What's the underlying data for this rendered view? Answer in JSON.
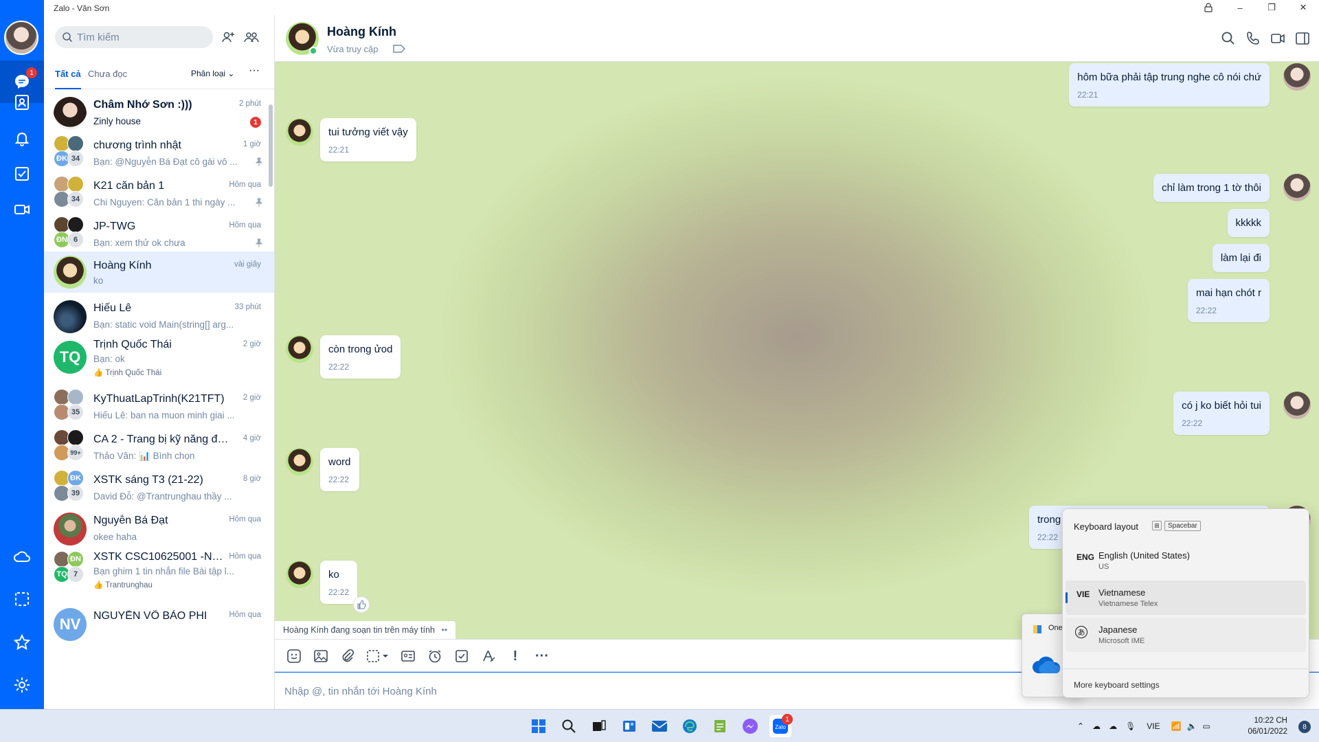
{
  "window": {
    "title": "Zalo - Văn Sơn"
  },
  "nav": {
    "chat_badge": "1"
  },
  "search": {
    "placeholder": "Tìm kiếm"
  },
  "tabs": {
    "all": "Tất cả",
    "unread": "Chưa đọc",
    "filter": "Phân loại"
  },
  "conversations": [
    {
      "name": "Châm Nhớ Sơn :)))",
      "preview": "Zinly house",
      "time": "2 phút",
      "unread": "1"
    },
    {
      "name": "chương trình nhật",
      "preview": "Bạn: @Nguyễn Bá Đạt cô gài vô ...",
      "time": "1 giờ",
      "members": "34",
      "initials": "ĐK"
    },
    {
      "name": "K21 căn bản 1",
      "preview": "Chi Nguyen: Căn bản 1 thi ngày ...",
      "time": "Hôm qua",
      "members": "34"
    },
    {
      "name": "JP-TWG",
      "preview": "Bạn: xem thử ok chưa",
      "time": "Hôm qua",
      "members": "6",
      "initials": "ĐN"
    },
    {
      "name": "Hoàng Kính",
      "preview": "ko",
      "time": "vài giây"
    },
    {
      "name": "Hiếu Lê",
      "preview": "Bạn: static void Main(string[] arg...",
      "time": "33 phút"
    },
    {
      "name": "Trịnh Quốc Thái",
      "preview": "Bạn: ok",
      "time": "2 giờ",
      "initials": "TQ",
      "sub": "👍 Trịnh Quốc Thái"
    },
    {
      "name": "KyThuatLapTrinh(K21TFT)",
      "preview": "Hiếu Lê: ban na muon minh giai ...",
      "time": "2 giờ",
      "members": "35"
    },
    {
      "name": "CA 2 - Trang bị kỹ năng đầu ...",
      "preview": "Thảo Vân: 📊 Bình chọn",
      "time": "4 giờ",
      "members": "99+"
    },
    {
      "name": "XSTK sáng T3 (21-22)",
      "preview": "David Đỗ: @Trantrunghau thầy ...",
      "time": "8 giờ",
      "members": "39",
      "initials": "ĐK"
    },
    {
      "name": "Nguyễn Bá Đạt",
      "preview": "okee haha",
      "time": "Hôm qua"
    },
    {
      "name": "XSTK CSC10625001 -Nhó...",
      "preview": "Bạn ghim 1 tin nhắn file Bài tập l...",
      "time": "Hôm qua",
      "members": "7",
      "initials": "ĐN",
      "initials2": "TQ",
      "sub": "👍 Trantrunghau"
    },
    {
      "name": "NGUYỄN VÕ BẢO PHI",
      "preview": "",
      "time": "Hôm qua",
      "initials": "NV"
    }
  ],
  "chat": {
    "name": "Hoàng Kính",
    "status": "Vừa truy cập",
    "typing": "Hoàng Kính đang soạn tin trên máy tính",
    "messages": [
      {
        "from": "me",
        "text": "hôm bữa phải tập trung nghe cô nói chứ",
        "time": "22:21"
      },
      {
        "from": "them",
        "text": "tui tưởng viết vậy",
        "time": "22:21"
      },
      {
        "from": "me",
        "text": "chỉ làm trong 1 tờ thôi",
        "time": ""
      },
      {
        "from": "me",
        "text": "kkkkk",
        "time": ""
      },
      {
        "from": "me",
        "text": "làm lại đi",
        "time": ""
      },
      {
        "from": "me",
        "text": "mai hạn chót r",
        "time": "22:22"
      },
      {
        "from": "them",
        "text": "còn trong ửod",
        "time": "22:22"
      },
      {
        "from": "me",
        "text": "có j ko biết hỏi tui",
        "time": "22:22"
      },
      {
        "from": "them",
        "text": "word",
        "time": "22:22"
      },
      {
        "from": "me",
        "text": "trong",
        "time": "22:22"
      },
      {
        "from": "them",
        "text": "ko",
        "time": "22:22"
      }
    ],
    "input_placeholder": "Nhập @, tin nhắn tới Hoàng Kính"
  },
  "onedrive": {
    "label": "One"
  },
  "keyboard_flyout": {
    "title": "Keyboard layout",
    "shortcut": "Spacebar",
    "options": [
      {
        "code": "ENG",
        "language": "English (United States)",
        "layout": "US"
      },
      {
        "code": "VIE",
        "language": "Vietnamese",
        "layout": "Vietnamese Telex",
        "selected": true
      },
      {
        "code": "あ",
        "language": "Japanese",
        "layout": "Microsoft IME"
      }
    ],
    "more": "More keyboard settings"
  },
  "taskbar": {
    "zalo_badge": "1",
    "lang": "VIE",
    "time": "10:22 CH",
    "date": "06/01/2022",
    "notifications": "8"
  }
}
